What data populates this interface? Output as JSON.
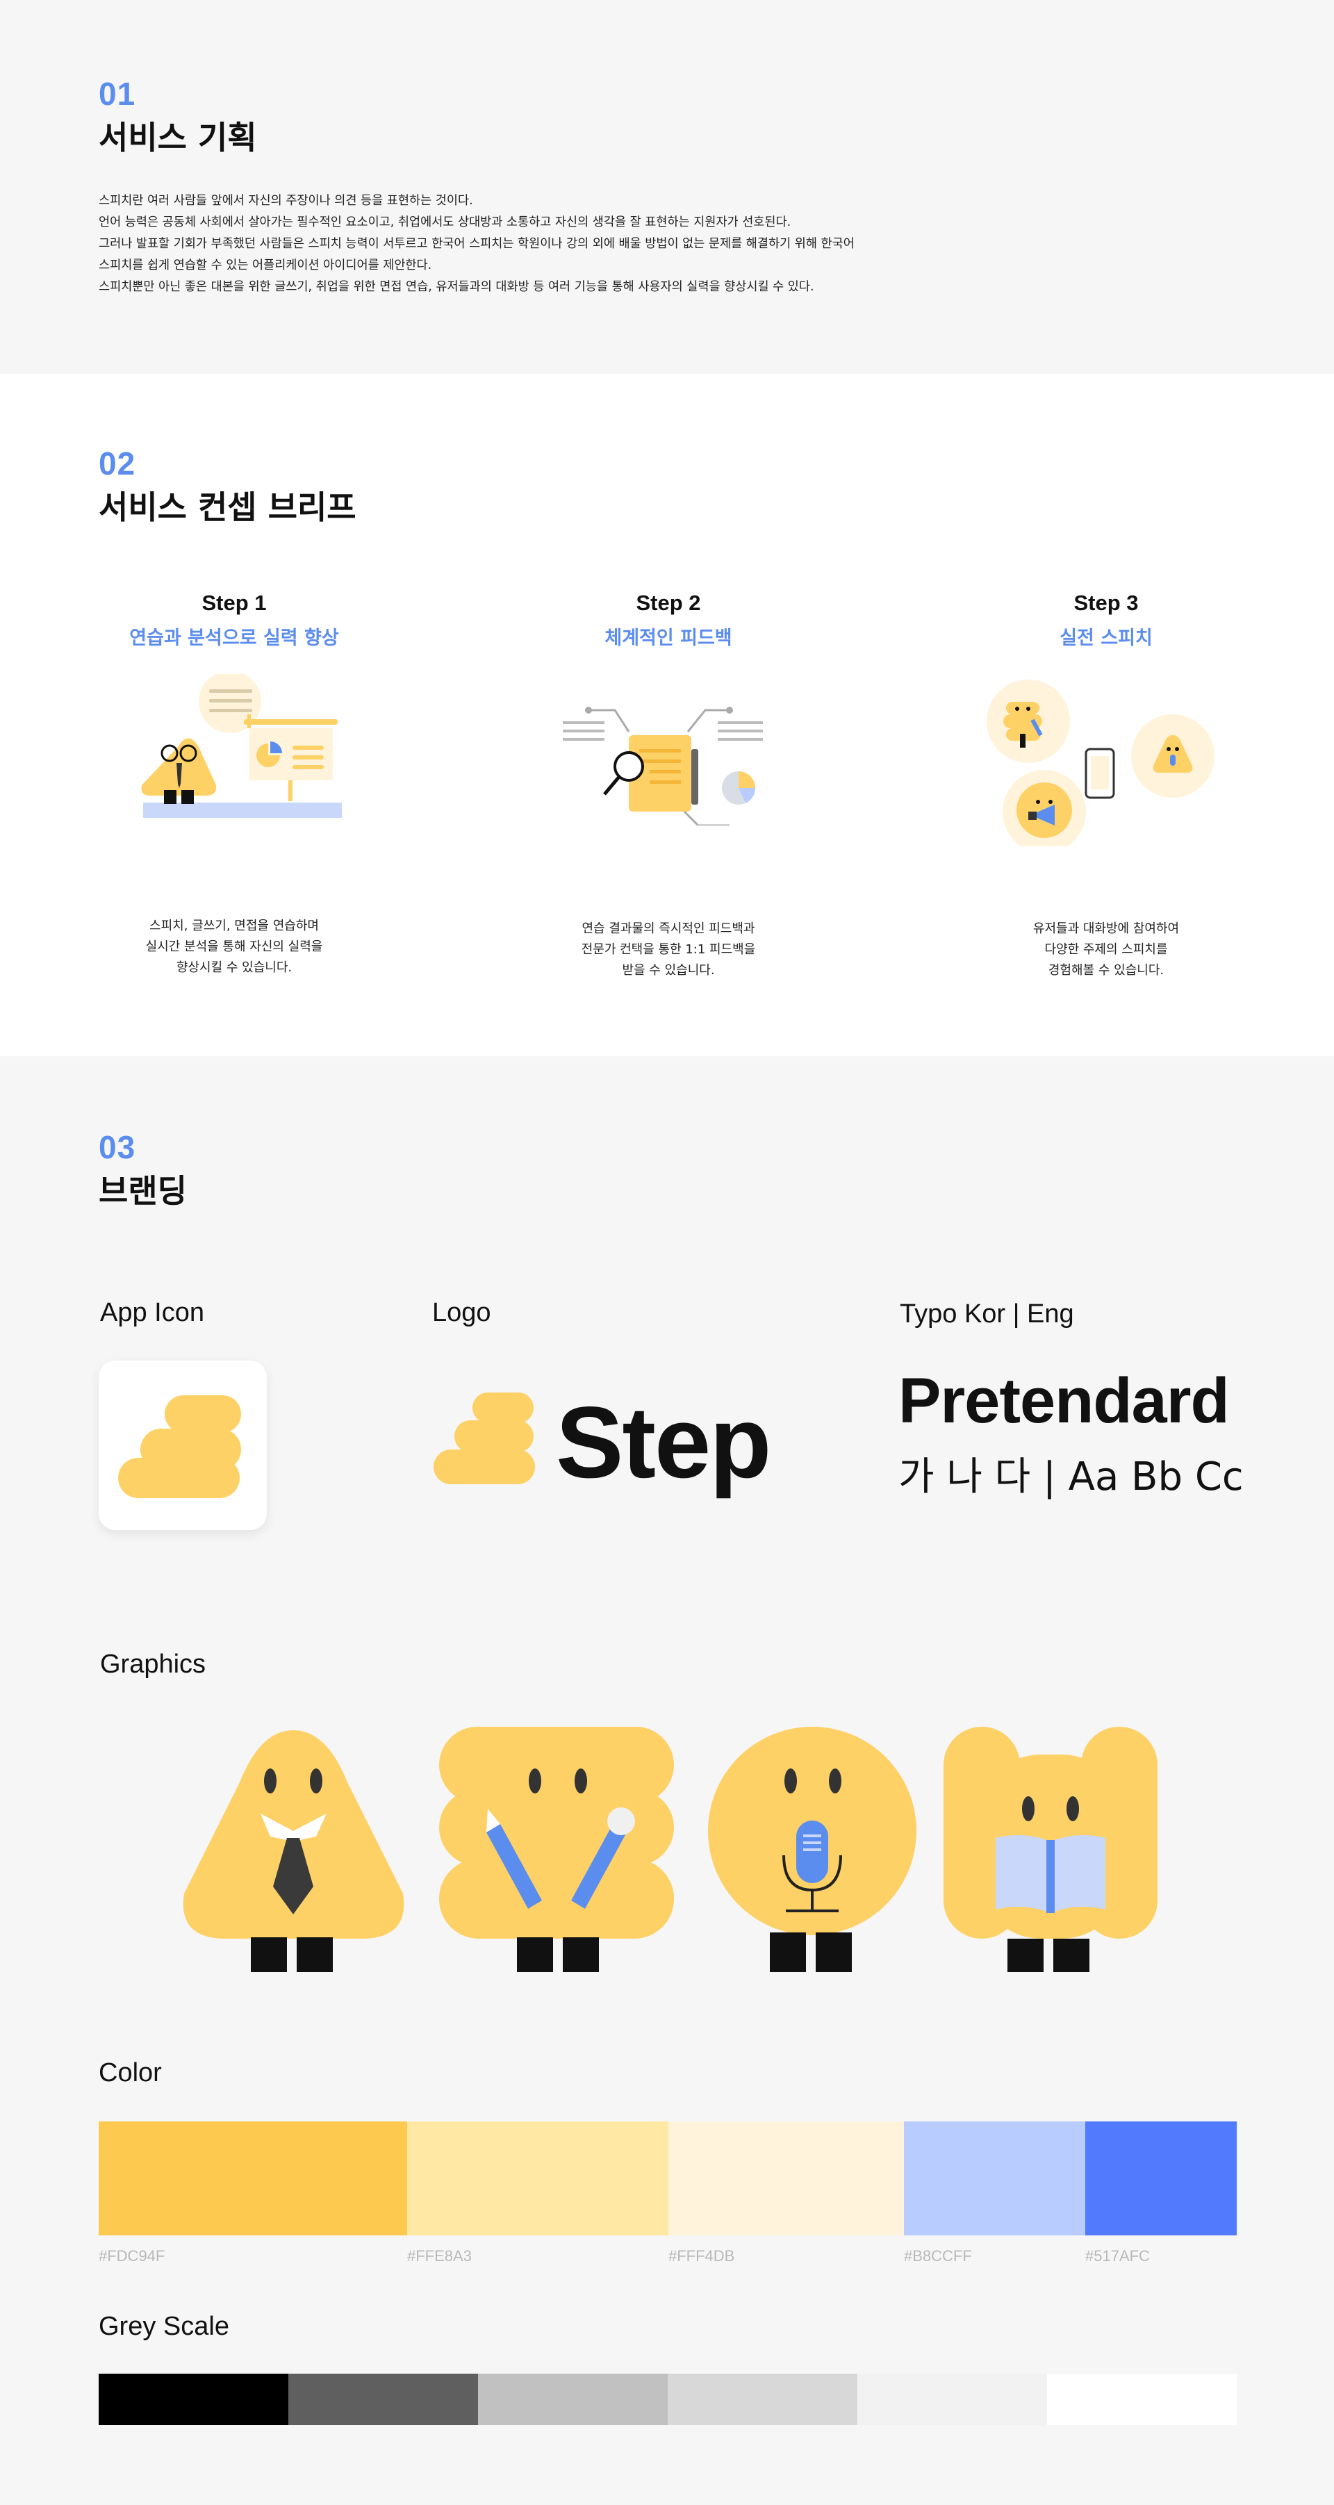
{
  "planning": {
    "number": "01",
    "title": "서비스 기획",
    "paragraphs": [
      "스피치란 여러 사람들 앞에서 자신의 주장이나 의견 등을 표현하는 것이다.",
      "언어 능력은 공동체 사회에서 살아가는 필수적인 요소이고, 취업에서도 상대방과 소통하고 자신의 생각을 잘 표현하는 지원자가 선호된다.",
      "그러나 발표할 기회가 부족했던 사람들은 스피치 능력이 서투르고 한국어 스피치는 학원이나 강의 외에 배울 방법이 없는 문제를 해결하기 위해 한국어",
      "스피치를 쉽게 연습할 수 있는 어플리케이션 아이디어를 제안한다.",
      "스피치뿐만 아닌 좋은 대본을 위한 글쓰기, 취업을 위한 면접 연습, 유저들과의 대화방 등 여러 기능을 통해 사용자의 실력을 향상시킬 수 있다."
    ]
  },
  "concept": {
    "number": "02",
    "title": "서비스 컨셉 브리프",
    "steps": [
      {
        "title": "Step 1",
        "subtitle": "연습과 분석으로 실력 향상",
        "desc": [
          "스피치, 글쓰기, 면접을 연습하며",
          "실시간 분석을 통해 자신의 실력을",
          "향상시킬 수 있습니다."
        ]
      },
      {
        "title": "Step 2",
        "subtitle": "체계적인 피드백",
        "desc": [
          "연습 결과물의 즉시적인 피드백과",
          "전문가 컨택을 통한 1:1 피드백을",
          "받을 수 있습니다."
        ]
      },
      {
        "title": "Step 3",
        "subtitle": "실전 스피치",
        "desc": [
          "유저들과 대화방에 참여하여",
          "다양한 주제의 스피치를",
          "경험해볼 수 있습니다."
        ]
      }
    ]
  },
  "branding": {
    "number": "03",
    "title": "브랜딩",
    "app_icon_label": "App Icon",
    "logo_label": "Logo",
    "logo_text": "Step",
    "typo_label": "Typo Kor | Eng",
    "typo_font": "Pretendard",
    "typo_sample": "가 나 다 | Aa Bb Cc",
    "graphics_label": "Graphics",
    "color_label": "Color",
    "colors": [
      {
        "hex": "#FDC94F",
        "label": "#FDC94F"
      },
      {
        "hex": "#FFE8A3",
        "label": "#FFE8A3"
      },
      {
        "hex": "#FFF4DB",
        "label": "#FFF4DB"
      },
      {
        "hex": "#B8CCFF",
        "label": "#B8CCFF"
      },
      {
        "hex": "#517AFC",
        "label": "#517AFC"
      }
    ],
    "grey_label": "Grey Scale",
    "greys": [
      "#000000",
      "#5f5f5f",
      "#c2c1c1",
      "#d8d8d8",
      "#f2f2f2",
      "#ffffff"
    ]
  },
  "palette": {
    "accent": "#5b8def",
    "yellow": "#fdd166",
    "dark": "#222222"
  }
}
